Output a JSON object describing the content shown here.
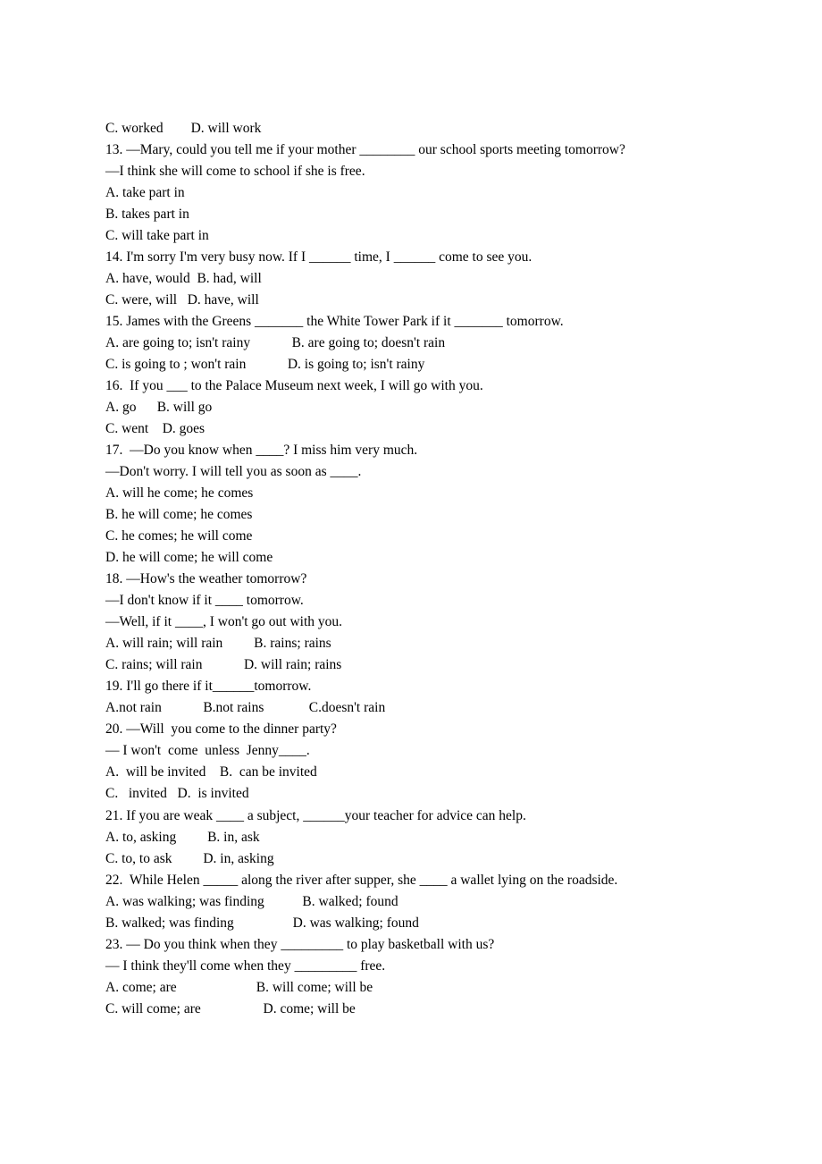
{
  "lines": [
    "C. worked        D. will work",
    "13. —Mary, could you tell me if your mother ________ our school sports meeting tomorrow?",
    "—I think she will come to school if she is free.",
    "A. take part in",
    "B. takes part in",
    "C. will take part in",
    "14. I'm sorry I'm very busy now. If I ______ time, I ______ come to see you.",
    "A. have, would  B. had, will",
    "C. were, will   D. have, will",
    "15. James with the Greens _______ the White Tower Park if it _______ tomorrow.",
    "A. are going to; isn't rainy            B. are going to; doesn't rain",
    "C. is going to ; won't rain            D. is going to; isn't rainy",
    "16.  If you ___ to the Palace Museum next week, I will go with you.",
    "A. go      B. will go",
    "C. went    D. goes",
    "17.  —Do you know when ____? I miss him very much.",
    "—Don't worry. I will tell you as soon as ____.",
    "A. will he come; he comes",
    "B. he will come; he comes",
    "C. he comes; he will come",
    "D. he will come; he will come",
    "18. —How's the weather tomorrow?",
    "—I don't know if it ____ tomorrow.",
    "—Well, if it ____, I won't go out with you.",
    "A. will rain; will rain         B. rains; rains",
    "C. rains; will rain            D. will rain; rains",
    "19. I'll go there if it______tomorrow.",
    "A.not rain            B.not rains             C.doesn't rain",
    "20. —Will  you come to the dinner party?",
    "— I won't  come  unless  Jenny____.",
    "A.  will be invited    B.  can be invited",
    "C.   invited   D.  is invited",
    "21. If you are weak ____ a subject, ______your teacher for advice can help.",
    "A. to, asking         B. in, ask",
    "C. to, to ask         D. in, asking",
    "22.  While Helen _____ along the river after supper, she ____ a wallet lying on the roadside.",
    "A. was walking; was finding           B. walked; found",
    "B. walked; was finding                 D. was walking; found",
    "23. — Do you think when they _________ to play basketball with us?",
    "— I think they'll come when they _________ free.",
    "A. come; are                       B. will come; will be",
    "C. will come; are                  D. come; will be"
  ]
}
